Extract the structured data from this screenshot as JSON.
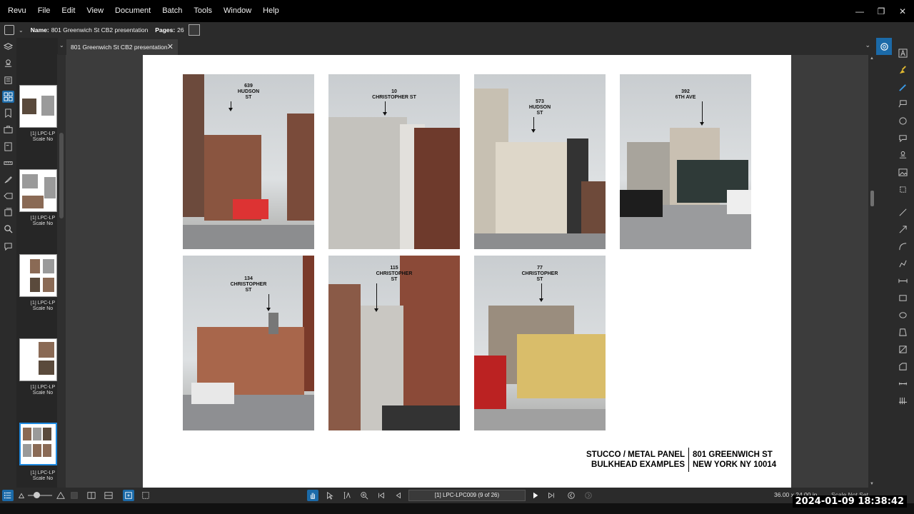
{
  "menubar": {
    "items": [
      "Revu",
      "File",
      "Edit",
      "View",
      "Document",
      "Batch",
      "Tools",
      "Window",
      "Help"
    ]
  },
  "propbar": {
    "name_label": "Name:",
    "name_value": "801 Greenwich St CB2 presentation",
    "pages_label": "Pages:",
    "pages_value": "26"
  },
  "tab": {
    "title": "801 Greenwich St CB2 presentation"
  },
  "thumbnails": [
    {
      "label1": "[1] LPC-LP",
      "label2": "Scale No"
    },
    {
      "label1": "[1] LPC-LP",
      "label2": "Scale No"
    },
    {
      "label1": "[1] LPC-LP",
      "label2": "Scale No"
    },
    {
      "label1": "[1] LPC-LP",
      "label2": "Scale No"
    },
    {
      "label1": "[1] LPC-LP",
      "label2": "Scale No"
    }
  ],
  "photos": [
    {
      "l1": "639",
      "l2": "HUDSON",
      "l3": "ST"
    },
    {
      "l1": "10",
      "l2": "CHRISTOPHER ST",
      "l3": ""
    },
    {
      "l1": "573",
      "l2": "HUDSON",
      "l3": "ST"
    },
    {
      "l1": "392",
      "l2": "6TH AVE",
      "l3": ""
    },
    {
      "l1": "134",
      "l2": "CHRISTOPHER",
      "l3": "ST"
    },
    {
      "l1": "115",
      "l2": "CHRISTOPHER",
      "l3": "ST"
    },
    {
      "l1": "77",
      "l2": "CHRISTOPHER",
      "l3": "ST"
    }
  ],
  "titleblock": {
    "left1": "STUCCO / METAL PANEL",
    "left2": "BULKHEAD EXAMPLES",
    "right1": "801 GREENWICH ST",
    "right2": "NEW YORK NY 10014"
  },
  "statusbar": {
    "page_field": "[1] LPC-LPC009 (9 of 26)",
    "size": "36.00 x 24.00 in",
    "scale": "Scale Not Set"
  },
  "timestamp": "2024-01-09 18:38:42",
  "colors": {
    "accent": "#1b6aa8",
    "menubar": "#000000",
    "panel": "#2b2b2b",
    "page": "#ffffff"
  }
}
